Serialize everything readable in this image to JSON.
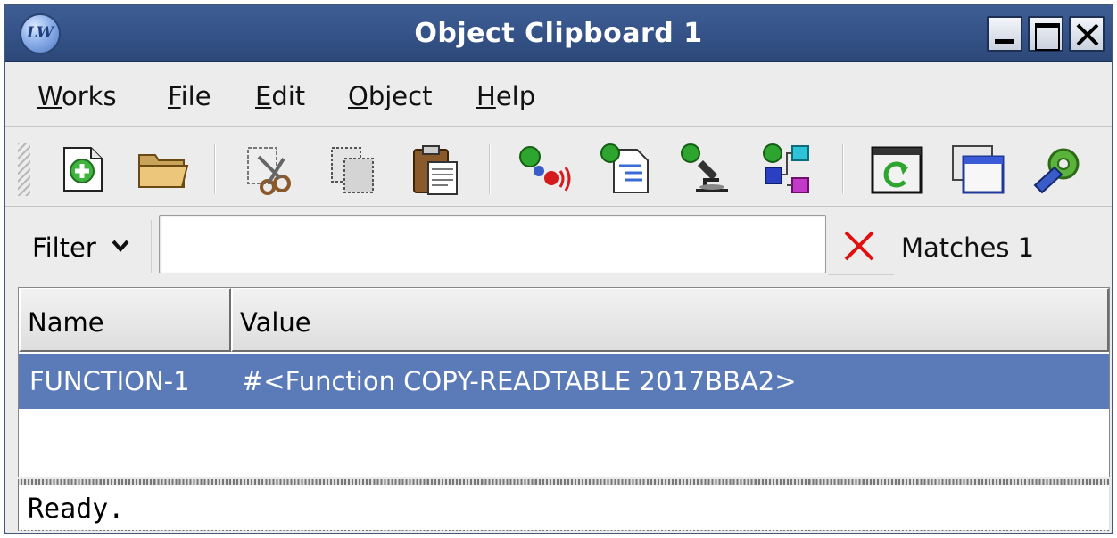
{
  "window": {
    "title": "Object Clipboard 1",
    "app_icon_text": "LW"
  },
  "menu": {
    "items": [
      {
        "mnemonic": "W",
        "rest": "orks"
      },
      {
        "mnemonic": "F",
        "rest": "ile"
      },
      {
        "mnemonic": "E",
        "rest": "dit"
      },
      {
        "mnemonic": "O",
        "rest": "bject"
      },
      {
        "mnemonic": "H",
        "rest": "elp"
      }
    ]
  },
  "toolbar": {
    "tools": [
      "new-icon",
      "open-folder-icon",
      "cut-icon",
      "copy-icon",
      "paste-icon",
      "broadcast-icon",
      "listen-icon",
      "inspect-icon",
      "browse-class-icon",
      "refresh-icon",
      "window-icon",
      "settings-icon"
    ]
  },
  "filter": {
    "label": "Filter",
    "value": "",
    "placeholder": "",
    "matches_text": "Matches 1"
  },
  "table": {
    "columns": [
      "Name",
      "Value"
    ],
    "rows": [
      {
        "name": "FUNCTION-1",
        "value": "#<Function COPY-READTABLE 2017BBA2>"
      }
    ]
  },
  "status": {
    "text": "Ready."
  },
  "colors": {
    "titlebar": "#36548a",
    "selection": "#5a7ab8",
    "clear_x": "#e01010"
  }
}
